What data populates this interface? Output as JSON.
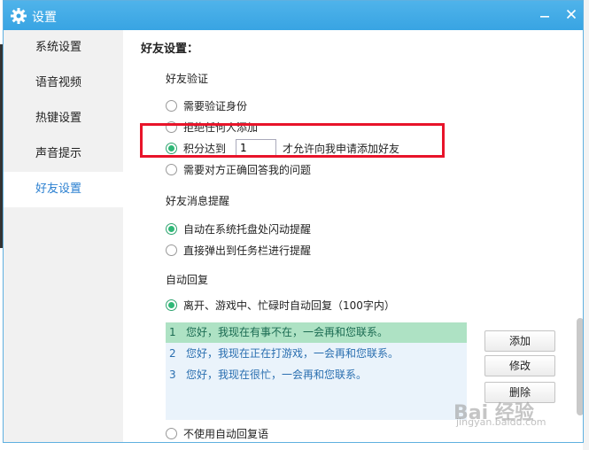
{
  "window": {
    "title": "设置"
  },
  "sidebar": {
    "items": [
      {
        "label": "系统设置"
      },
      {
        "label": "语音视频"
      },
      {
        "label": "热键设置"
      },
      {
        "label": "声音提示"
      },
      {
        "label": "好友设置"
      }
    ],
    "active_index": 4
  },
  "content": {
    "section_title": "好友设置：",
    "verify": {
      "title": "好友验证",
      "opt_need_verify": "需要验证身份",
      "opt_reject_all": "拒绝任何人添加",
      "opt_score_prefix": "积分达到",
      "score_value": "1",
      "opt_score_suffix": "才允许向我申请添加好友",
      "opt_question": "需要对方正确回答我的问题",
      "selected": "score"
    },
    "message_alert": {
      "title": "好友消息提醒",
      "opt_tray": "自动在系统托盘处闪动提醒",
      "opt_popup": "直接弹出到任务栏进行提醒",
      "selected": "tray"
    },
    "auto_reply": {
      "title": "自动回复",
      "opt_enable": "离开、游戏中、忙碌时自动回复（100字内）",
      "replies": [
        {
          "num": "1",
          "text": "您好，我现在有事不在，一会再和您联系。"
        },
        {
          "num": "2",
          "text": "您好，我现在正在打游戏，一会再和您联系。"
        },
        {
          "num": "3",
          "text": "您好，我现在很忙，一会再和您联系。"
        }
      ],
      "selected_reply_index": 0,
      "add_label": "添加",
      "edit_label": "修改",
      "delete_label": "删除",
      "opt_disable": "不使用自动回复语"
    }
  },
  "watermark": {
    "text": "Bai  经验",
    "sub": "jingyan.baidu.com"
  },
  "colors": {
    "titlebar": "#38a4e3",
    "accent": "#2a7fd0",
    "radio_selected": "#2fb877",
    "highlight": "#e8142a"
  }
}
